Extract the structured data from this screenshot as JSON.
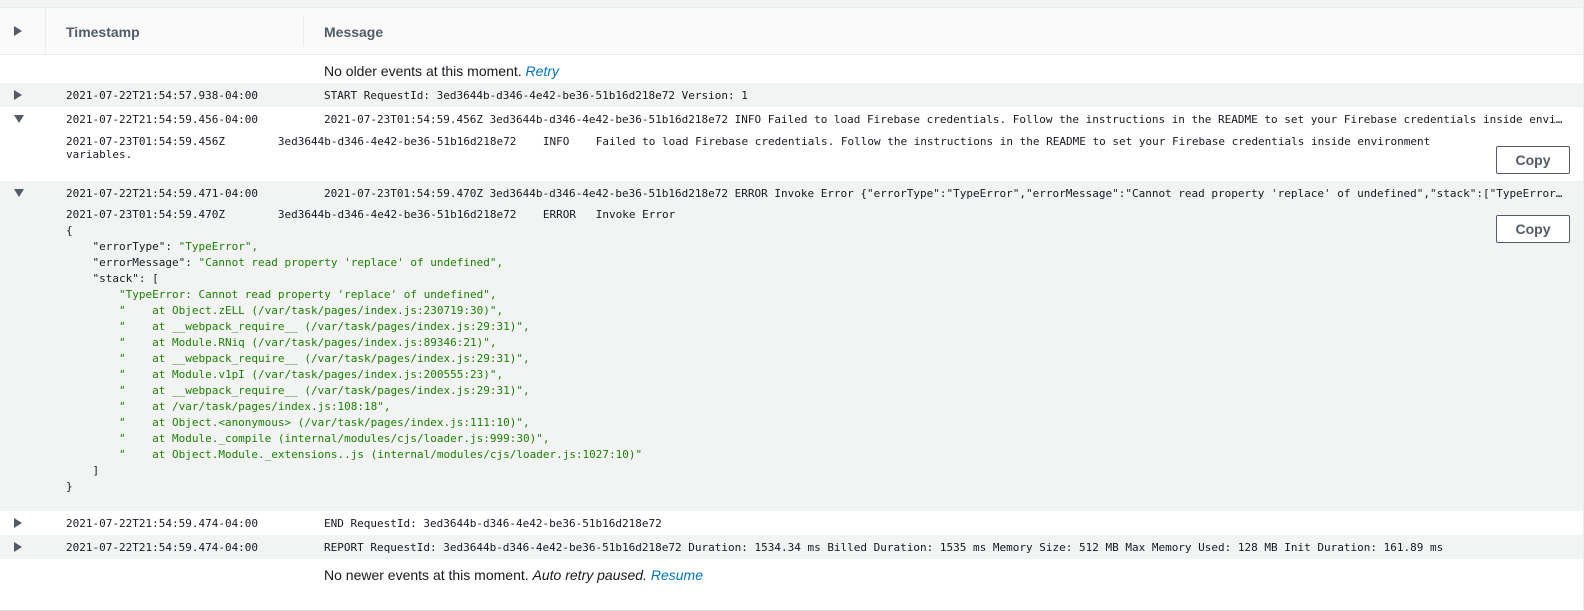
{
  "header": {
    "timestamp_label": "Timestamp",
    "message_label": "Message"
  },
  "older_notice": {
    "text": "No older events at this moment. ",
    "link": "Retry"
  },
  "newer_notice": {
    "text": "No newer events at this moment. ",
    "italic": "Auto retry paused.",
    "link": "Resume"
  },
  "events": [
    {
      "timestamp": "2021-07-22T21:54:57.938-04:00",
      "message": "START RequestId: 3ed3644b-d346-4e42-be36-51b16d218e72 Version: 1"
    },
    {
      "timestamp": "2021-07-22T21:54:59.456-04:00",
      "message": "2021-07-23T01:54:59.456Z 3ed3644b-d346-4e42-be36-51b16d218e72 INFO Failed to load Firebase credentials. Follow the instructions in the README to set your Firebase credentials inside envi..."
    },
    {
      "timestamp": "2021-07-22T21:54:59.471-04:00",
      "message": "2021-07-23T01:54:59.470Z 3ed3644b-d346-4e42-be36-51b16d218e72 ERROR Invoke Error {\"errorType\":\"TypeError\",\"errorMessage\":\"Cannot read property 'replace' of undefined\",\"stack\":[\"TypeError..."
    },
    {
      "timestamp": "2021-07-22T21:54:59.474-04:00",
      "message": "END RequestId: 3ed3644b-d346-4e42-be36-51b16d218e72"
    },
    {
      "timestamp": "2021-07-22T21:54:59.474-04:00",
      "message": "REPORT RequestId: 3ed3644b-d346-4e42-be36-51b16d218e72 Duration: 1534.34 ms Billed Duration: 1535 ms Memory Size: 512 MB Max Memory Used: 128 MB Init Duration: 161.89 ms"
    }
  ],
  "info_detail": {
    "line1": "2021-07-23T01:54:59.456Z        3ed3644b-d346-4e42-be36-51b16d218e72    INFO    Failed to load Firebase credentials. Follow the instructions in the README to set your Firebase credentials inside environment",
    "line2": "variables."
  },
  "error_detail": {
    "head": "2021-07-23T01:54:59.470Z        3ed3644b-d346-4e42-be36-51b16d218e72    ERROR   Invoke Error ",
    "open_brace": "{",
    "error_type_key": "    \"errorType\": ",
    "error_type_val": "\"TypeError\",",
    "error_message_key": "    \"errorMessage\": ",
    "error_message_val": "\"Cannot read property 'replace' of undefined\",",
    "stack_key": "    \"stack\": [",
    "stack": [
      "        \"TypeError: Cannot read property 'replace' of undefined\",",
      "        \"    at Object.zELL (/var/task/pages/index.js:230719:30)\",",
      "        \"    at __webpack_require__ (/var/task/pages/index.js:29:31)\",",
      "        \"    at Module.RNiq (/var/task/pages/index.js:89346:21)\",",
      "        \"    at __webpack_require__ (/var/task/pages/index.js:29:31)\",",
      "        \"    at Module.v1pI (/var/task/pages/index.js:200555:23)\",",
      "        \"    at __webpack_require__ (/var/task/pages/index.js:29:31)\",",
      "        \"    at /var/task/pages/index.js:108:18\",",
      "        \"    at Object.<anonymous> (/var/task/pages/index.js:111:10)\",",
      "        \"    at Module._compile (internal/modules/cjs/loader.js:999:30)\",",
      "        \"    at Object.Module._extensions..js (internal/modules/cjs/loader.js:1027:10)\""
    ],
    "close_bracket": "    ]",
    "close_brace": "}"
  },
  "copy_label": "Copy"
}
